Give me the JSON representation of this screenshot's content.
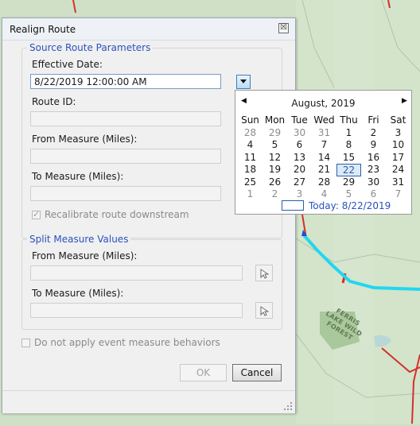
{
  "map": {
    "label_lines": [
      "FERRIS",
      "LAKE WILD",
      "FOREST"
    ]
  },
  "dialog": {
    "title": "Realign Route",
    "close_glyph": "☒",
    "source_group": {
      "title": "Source Route Parameters",
      "effective_date_label": "Effective Date:",
      "effective_date_value": "8/22/2019 12:00:00 AM",
      "route_id_label": "Route ID:",
      "route_id_value": "",
      "from_measure_label": "From Measure (Miles):",
      "from_measure_value": "",
      "to_measure_label": "To Measure (Miles):",
      "to_measure_value": "",
      "recalibrate_label": "Recalibrate route downstream",
      "recalibrate_checked": true
    },
    "split_group": {
      "title": "Split Measure Values",
      "from_measure_label": "From Measure (Miles):",
      "from_measure_value": "",
      "to_measure_label": "To Measure (Miles):",
      "to_measure_value": ""
    },
    "do_not_apply_label": "Do not apply event measure behaviors",
    "do_not_apply_checked": false,
    "ok_label": "OK",
    "cancel_label": "Cancel"
  },
  "calendar": {
    "prev_glyph": "◀",
    "next_glyph": "▶",
    "month_title": "August, 2019",
    "weekdays": [
      "Sun",
      "Mon",
      "Tue",
      "Wed",
      "Thu",
      "Fri",
      "Sat"
    ],
    "weeks": [
      [
        {
          "d": "28",
          "o": true
        },
        {
          "d": "29",
          "o": true
        },
        {
          "d": "30",
          "o": true
        },
        {
          "d": "31",
          "o": true
        },
        {
          "d": "1"
        },
        {
          "d": "2"
        },
        {
          "d": "3"
        }
      ],
      [
        {
          "d": "4"
        },
        {
          "d": "5"
        },
        {
          "d": "6"
        },
        {
          "d": "7"
        },
        {
          "d": "8"
        },
        {
          "d": "9"
        },
        {
          "d": "10"
        }
      ],
      [
        {
          "d": "11"
        },
        {
          "d": "12"
        },
        {
          "d": "13"
        },
        {
          "d": "14"
        },
        {
          "d": "15"
        },
        {
          "d": "16"
        },
        {
          "d": "17"
        }
      ],
      [
        {
          "d": "18"
        },
        {
          "d": "19"
        },
        {
          "d": "20"
        },
        {
          "d": "21"
        },
        {
          "d": "22",
          "today": true
        },
        {
          "d": "23"
        },
        {
          "d": "24"
        }
      ],
      [
        {
          "d": "25"
        },
        {
          "d": "26"
        },
        {
          "d": "27"
        },
        {
          "d": "28"
        },
        {
          "d": "29"
        },
        {
          "d": "30"
        },
        {
          "d": "31"
        }
      ],
      [
        {
          "d": "1",
          "o": true
        },
        {
          "d": "2",
          "o": true
        },
        {
          "d": "3",
          "o": true
        },
        {
          "d": "4",
          "o": true
        },
        {
          "d": "5",
          "o": true
        },
        {
          "d": "6",
          "o": true
        },
        {
          "d": "7",
          "o": true
        }
      ]
    ],
    "today_label": "Today: 8/22/2019"
  },
  "colors": {
    "accent": "#2a52be",
    "map_bg": "#cfe0c6",
    "route_highlight": "#22d6f0",
    "route_red": "#d4302a"
  }
}
